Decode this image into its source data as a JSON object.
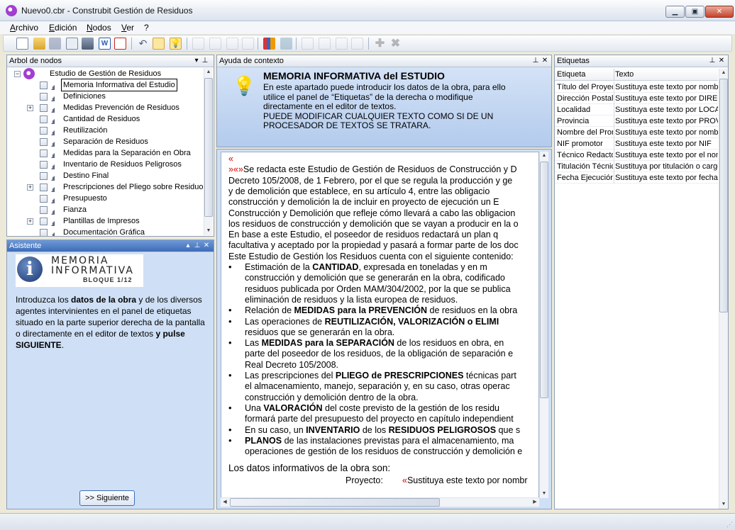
{
  "window": {
    "title": "Nuevo0.cbr - Construbit Gestión de Residuos"
  },
  "menu": [
    "Archivo",
    "Edición",
    "Nodos",
    "Ver",
    "?"
  ],
  "panels": {
    "tree_title": "Arbol de nodos",
    "help_title": "Ayuda de contexto",
    "tags_title": "Etiquetas",
    "assistant_title": "Asistente"
  },
  "tree": {
    "root": "Estudio de Gestión de Residuos",
    "items": [
      {
        "label": "Memoria Informativa del Estudio",
        "expandable": false,
        "selected": true
      },
      {
        "label": "Definiciones",
        "expandable": false
      },
      {
        "label": "Medidas Prevención de Residuos",
        "expandable": true
      },
      {
        "label": "Cantidad de Residuos",
        "expandable": false
      },
      {
        "label": "Reutilización",
        "expandable": false
      },
      {
        "label": "Separación de Residuos",
        "expandable": false
      },
      {
        "label": "Medidas para la Separación en Obra",
        "expandable": false
      },
      {
        "label": "Inventario de Residuos Peligrosos",
        "expandable": false
      },
      {
        "label": "Destino Final",
        "expandable": false
      },
      {
        "label": "Prescripciones del Pliego sobre Residuos",
        "expandable": true
      },
      {
        "label": "Presupuesto",
        "expandable": false
      },
      {
        "label": "Fianza",
        "expandable": false
      },
      {
        "label": "Plantillas de Impresos",
        "expandable": true
      },
      {
        "label": "Documentación Gráfica",
        "expandable": false
      }
    ]
  },
  "help": {
    "title": "MEMORIA INFORMATIVA del ESTUDIO",
    "lines": [
      "En este apartado puede introducir los datos de la obra, para ello",
      "utilice el panel de “Etiquetas” de la derecha o modifique",
      "directamente en el editor de textos.",
      "PUEDE MODIFICAR CUALQUIER TEXTO COMO SI DE UN",
      "PROCESADOR DE TEXTOS SE TRATARA."
    ]
  },
  "editor": {
    "marker": "«",
    "marker2": "»«»",
    "p1": [
      "Se redacta este Estudio de Gestión de Residuos de Construcción y D",
      "Decreto 105/2008, de 1 Febrero, por el que se regula la producción y ge",
      "y de demolición que establece, en su artículo 4, entre las obligacio",
      "construcción y demolición la de incluir en proyecto de ejecución un E",
      "Construcción y Demolición que refleje cómo llevará a cabo las obligacion",
      "los residuos de construcción y demolición que se vayan a producir en la o",
      "En base a este Estudio, el poseedor de residuos redactará un plan q",
      "facultativa y aceptado por la propiedad y pasará a formar parte de los doc",
      "Este Estudio de Gestión los Residuos cuenta con el siguiente contenido:"
    ],
    "b1": {
      "pre": "Estimación de la ",
      "bold": "CANTIDAD",
      "post": ", expresada en toneladas y en m",
      "rest": [
        "construcción y demolición que se generarán en la obra, codificado",
        "residuos publicada por Orden MAM/304/2002, por la que se publica",
        "eliminación de residuos y la lista europea de residuos."
      ]
    },
    "b2": {
      "pre": "Relación de ",
      "bold": "MEDIDAS para la PREVENCIÓN",
      "post": " de residuos en la obra"
    },
    "b3": {
      "pre": "Las operaciones de ",
      "bold": "REUTILIZACIÓN, VALORIZACIÓN o ELIMI",
      "rest": [
        "residuos que se generarán en la obra."
      ]
    },
    "b4": {
      "pre": "Las ",
      "bold": "MEDIDAS para la SEPARACIÓN",
      "post": " de los residuos en obra, en",
      "rest": [
        "parte del poseedor de los residuos, de la obligación de separación e",
        "Real Decreto 105/2008."
      ]
    },
    "b5": {
      "pre": "Las prescripciones del ",
      "bold": "PLIEGO de PRESCRIPCIONES",
      "post": " técnicas part",
      "rest": [
        "el almacenamiento, manejo, separación y, en su caso, otras operac",
        "construcción y demolición dentro de la obra."
      ]
    },
    "b6": {
      "pre": "Una ",
      "bold": "VALORACIÓN",
      "post": " del coste previsto de la gestión de los residu",
      "rest": [
        "formará parte del presupuesto del proyecto en capítulo independient"
      ]
    },
    "b7": {
      "pre": "En su caso, un ",
      "bold": "INVENTARIO",
      "mid": " de los ",
      "bold2": "RESIDUOS PELIGROSOS",
      "post": " que s"
    },
    "b8": {
      "bold": "PLANOS",
      "post": " de las instalaciones previstas para el almacenamiento, ma",
      "rest": [
        "operaciones de gestión de los residuos de construcción y demolición e"
      ]
    },
    "datos": "Los datos informativos de la obra son:",
    "proyecto_label": "Proyecto:",
    "proyecto_marker": "«",
    "proyecto_value": "Sustituya este texto por nombr"
  },
  "assistant": {
    "logo_line1": "MEMORIA",
    "logo_line2": "INFORMATIVA",
    "logo_line3": "BLOQUE 1/12",
    "text": [
      {
        "t": "Introduzca los "
      },
      {
        "t": "datos de la obra",
        "b": true
      },
      {
        "t": " y de los diversos agentes intervinientes en el panel de etiquetas situado en la parte superior derecha de la pantalla o directamente en el editor de textos"
      },
      {
        "t": " y pulse SIGUIENTE",
        "b": true
      },
      {
        "t": "."
      }
    ],
    "next_button": ">> Siguiente"
  },
  "tags": {
    "col1": "Etiqueta",
    "col2": "Texto",
    "rows": [
      [
        "Título del Proyecto",
        "Sustituya este texto por nombre"
      ],
      [
        "Dirección Postal de",
        "Sustituya este texto por DIRECCIÓN"
      ],
      [
        "Localidad",
        "Sustituya este texto por LOCALIDAD"
      ],
      [
        "Provincia",
        "Sustituya este texto por PROVINCIA"
      ],
      [
        "Nombre del Promotor",
        "Sustituya este texto por nombre"
      ],
      [
        "NIF promotor",
        "Sustituya este texto por NIF"
      ],
      [
        "Técnico Redactor",
        "Sustituya este texto por el nombre"
      ],
      [
        "Titulación Técnico",
        "Sustituya por titulación o cargo"
      ],
      [
        "Fecha Ejecución",
        "Sustituya este texto por fecha"
      ]
    ]
  }
}
